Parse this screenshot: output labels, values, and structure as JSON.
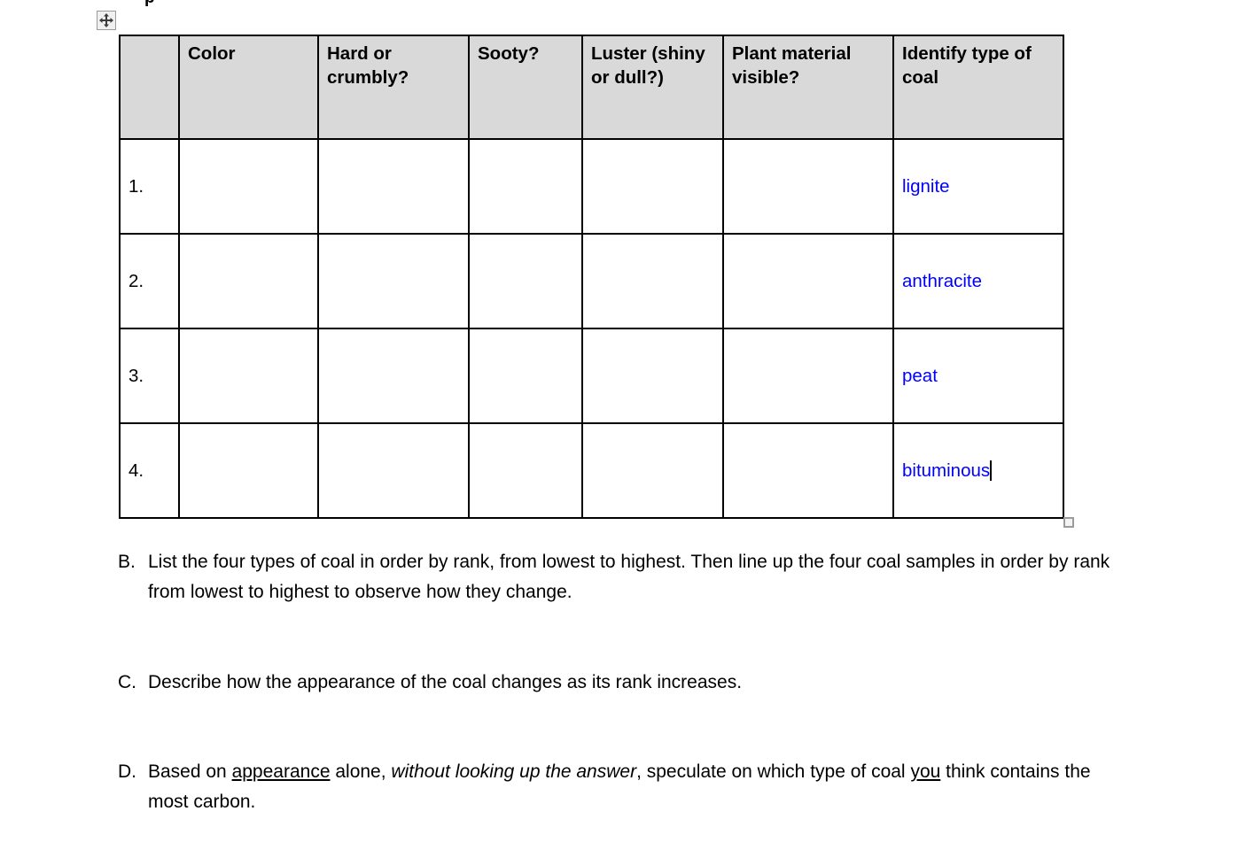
{
  "document": {
    "top_cut_text": "p",
    "table_move_handle_icon": "move-four-arrows-icon",
    "table_resize_handle_icon": "resize-handle-icon"
  },
  "table": {
    "header_background": "#D9D9D9",
    "answer_color": "#0000FF",
    "columns": [
      {
        "key": "num",
        "label": ""
      },
      {
        "key": "color",
        "label": "Color"
      },
      {
        "key": "hard",
        "label": "Hard or crumbly?"
      },
      {
        "key": "sooty",
        "label": "Sooty?"
      },
      {
        "key": "luster",
        "label": "Luster (shiny or dull?)"
      },
      {
        "key": "plant",
        "label": "Plant material visible?"
      },
      {
        "key": "type",
        "label": "Identify type of coal"
      }
    ],
    "rows": [
      {
        "num": "1.",
        "color": "",
        "hard": "",
        "sooty": "",
        "luster": "",
        "plant": "",
        "type": "lignite",
        "caret": false
      },
      {
        "num": "2.",
        "color": "",
        "hard": "",
        "sooty": "",
        "luster": "",
        "plant": "",
        "type": "anthracite",
        "caret": false
      },
      {
        "num": "3.",
        "color": "",
        "hard": "",
        "sooty": "",
        "luster": "",
        "plant": "",
        "type": "peat",
        "caret": false
      },
      {
        "num": "4.",
        "color": "",
        "hard": "",
        "sooty": "",
        "luster": "",
        "plant": "",
        "type": "bituminous",
        "caret": true
      }
    ]
  },
  "questions": [
    {
      "label": "B.",
      "text": "List the four types of coal in order by rank, from lowest to highest. Then line up the four coal samples in order by rank from lowest to highest to observe how they change."
    },
    {
      "label": "C.",
      "text": "Describe how the appearance of the coal changes as its rank increases."
    },
    {
      "label": "D.",
      "text": "Based on appearance alone, without looking up the answer, speculate on which type of coal you think contains the most carbon.",
      "segments": [
        {
          "text": "Based on ",
          "style": "normal"
        },
        {
          "text": "appearance",
          "style": "underline"
        },
        {
          "text": " alone, ",
          "style": "normal"
        },
        {
          "text": "without looking up the answer",
          "style": "italic"
        },
        {
          "text": ", speculate on which type of coal ",
          "style": "normal"
        },
        {
          "text": "you",
          "style": "underline"
        },
        {
          "text": " think contains the most carbon.",
          "style": "normal"
        }
      ]
    }
  ]
}
